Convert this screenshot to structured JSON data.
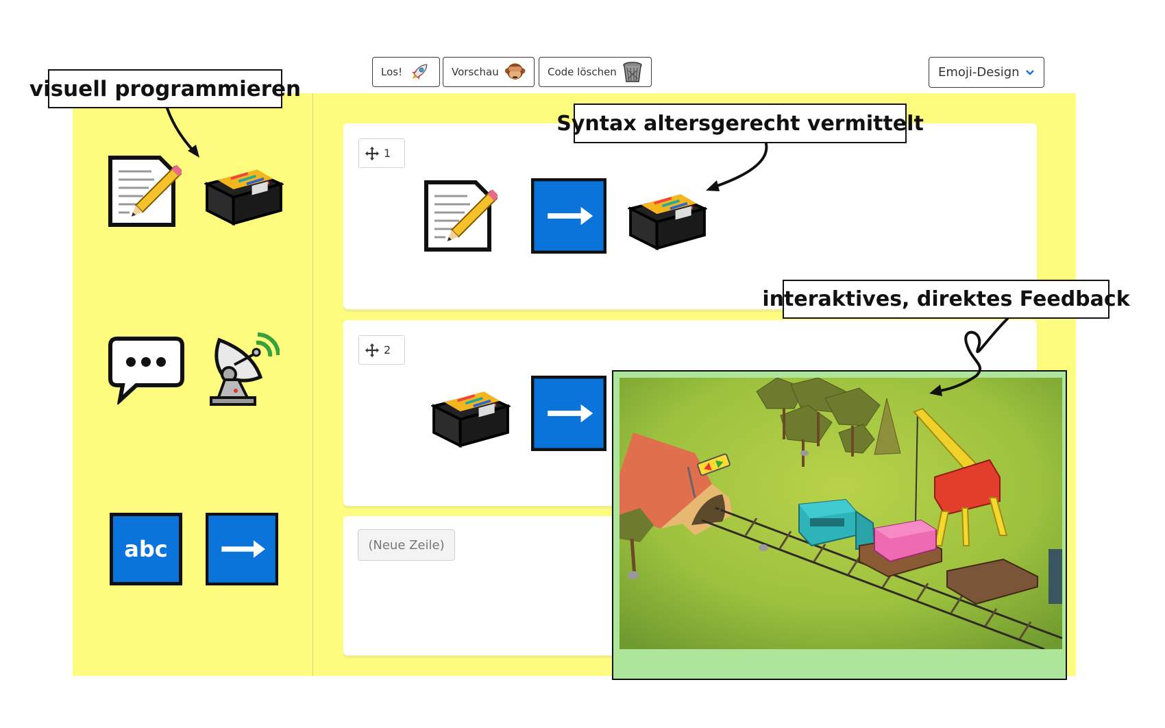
{
  "toolbar": {
    "run_label": "Los!",
    "preview_label": "Vorschau",
    "clear_label": "Code löschen",
    "design_select": "Emoji-Design"
  },
  "rows": [
    {
      "number": "1"
    },
    {
      "number": "2"
    },
    {
      "new_row_label": "(Neue Zeile)"
    }
  ],
  "palette": {
    "abc_label": "abc"
  },
  "callouts": {
    "visual": "visuell programmieren",
    "syntax": "Syntax altersgerecht vermittelt",
    "feedback": "interaktives, direktes Feedback"
  },
  "icons": {
    "run": "rocket-icon",
    "preview": "monkey-icon",
    "clear": "trash-icon",
    "select": "chevron-down-icon",
    "move": "move-icon",
    "memo": "memo-icon",
    "file_box": "card-file-box-icon",
    "arrow": "right-arrow-icon",
    "speech": "speech-bubble-icon",
    "satellite": "satellite-dish-icon"
  },
  "colors": {
    "workspace": "#fefc7e",
    "tile_blue": "#0a74da",
    "preview_bg": "#ade59b"
  }
}
